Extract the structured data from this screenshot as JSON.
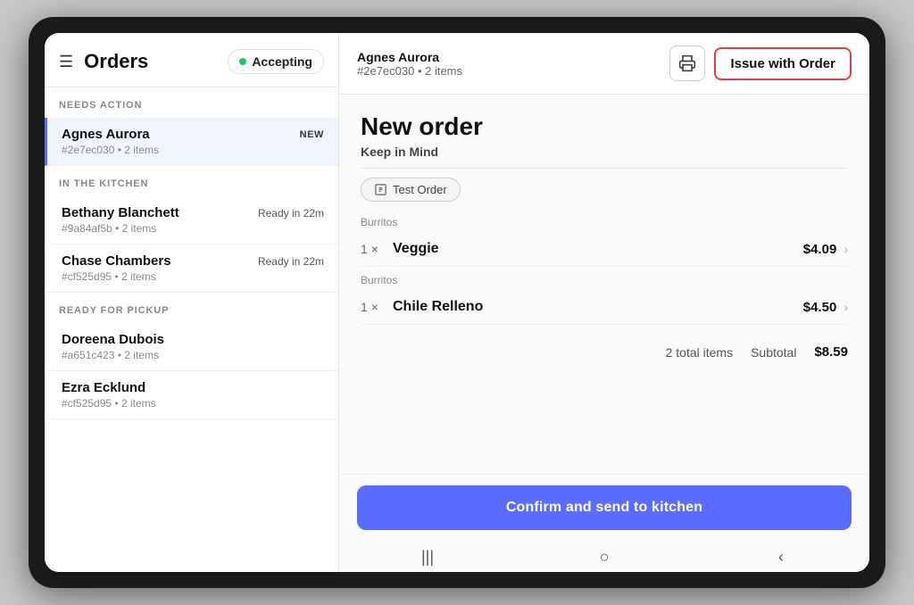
{
  "sidebar": {
    "title": "Orders",
    "accepting_label": "Accepting",
    "sections": [
      {
        "label": "NEEDS ACTION",
        "items": [
          {
            "name": "Agnes Aurora",
            "id": "#2e7ec030",
            "items_count": "2 items",
            "badge": "NEW",
            "ready": "",
            "active": true
          }
        ]
      },
      {
        "label": "IN THE KITCHEN",
        "items": [
          {
            "name": "Bethany Blanchett",
            "id": "#9a84af5b",
            "items_count": "2 items",
            "badge": "",
            "ready": "Ready in 22m",
            "active": false
          },
          {
            "name": "Chase Chambers",
            "id": "#cf525d95",
            "items_count": "2 items",
            "badge": "",
            "ready": "Ready in 22m",
            "active": false
          }
        ]
      },
      {
        "label": "READY FOR PICKUP",
        "items": [
          {
            "name": "Doreena Dubois",
            "id": "#a651c423",
            "items_count": "2 items",
            "badge": "",
            "ready": "",
            "active": false
          },
          {
            "name": "Ezra Ecklund",
            "id": "#cf525d95",
            "items_count": "2 items",
            "badge": "",
            "ready": "",
            "active": false
          }
        ]
      }
    ]
  },
  "top_bar": {
    "customer_name": "Agnes Aurora",
    "order_id_items": "#2e7ec030 • 2 items",
    "issue_button_label": "Issue with Order"
  },
  "order_detail": {
    "title": "New order",
    "keep_in_mind": "Keep in Mind",
    "test_order_label": "Test Order",
    "items": [
      {
        "category": "Burritos",
        "qty": "1 ×",
        "name": "Veggie",
        "price": "$4.09"
      },
      {
        "category": "Burritos",
        "qty": "1 ×",
        "name": "Chile Relleno",
        "price": "$4.50"
      }
    ],
    "totals": {
      "count_label": "2 total items",
      "subtotal_label": "Subtotal",
      "subtotal_amount": "$8.59"
    },
    "confirm_button_label": "Confirm and send to kitchen"
  },
  "nav": {
    "icons": [
      "|||",
      "○",
      "<"
    ]
  }
}
